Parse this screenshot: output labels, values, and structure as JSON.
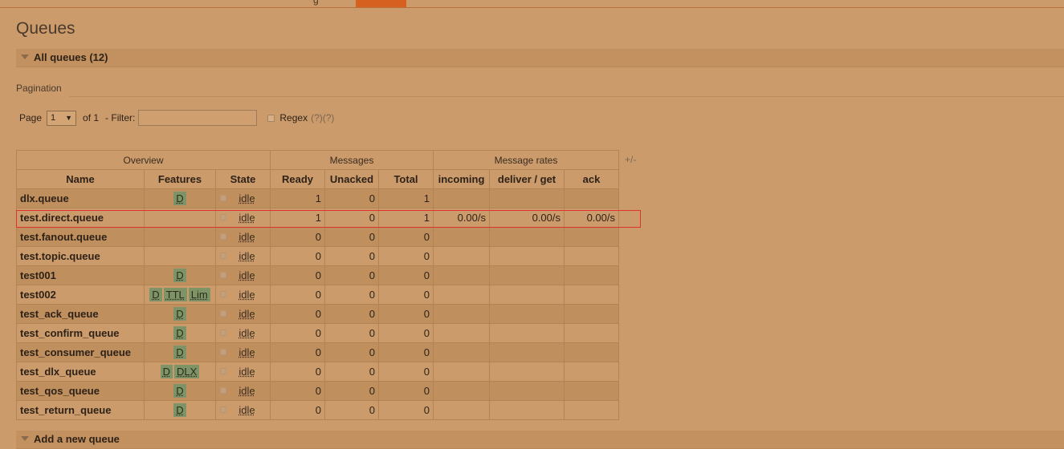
{
  "topnav": {
    "stub_text": "g"
  },
  "page": {
    "title": "Queues",
    "all_queues_label": "All queues (12)",
    "pagination_label": "Pagination",
    "add_queue_label": "Add a new queue"
  },
  "pager": {
    "page_label": "Page",
    "page_value": "1",
    "of_label": "of 1",
    "filter_label": "- Filter:",
    "filter_value": "",
    "regex_label": "Regex",
    "help1": "(?)",
    "help2": "(?)"
  },
  "table": {
    "groups": [
      "Overview",
      "Messages",
      "Message rates"
    ],
    "plus_minus": "+/-",
    "columns": [
      "Name",
      "Features",
      "State",
      "Ready",
      "Unacked",
      "Total",
      "incoming",
      "deliver / get",
      "ack"
    ],
    "rows": [
      {
        "name": "dlx.queue",
        "features": [
          "D"
        ],
        "state": "idle",
        "ready": "1",
        "unacked": "0",
        "total": "1",
        "incoming": "",
        "deliver": "",
        "ack": ""
      },
      {
        "name": "test.direct.queue",
        "features": [],
        "state": "idle",
        "ready": "1",
        "unacked": "0",
        "total": "1",
        "incoming": "0.00/s",
        "deliver": "0.00/s",
        "ack": "0.00/s"
      },
      {
        "name": "test.fanout.queue",
        "features": [],
        "state": "idle",
        "ready": "0",
        "unacked": "0",
        "total": "0",
        "incoming": "",
        "deliver": "",
        "ack": ""
      },
      {
        "name": "test.topic.queue",
        "features": [],
        "state": "idle",
        "ready": "0",
        "unacked": "0",
        "total": "0",
        "incoming": "",
        "deliver": "",
        "ack": ""
      },
      {
        "name": "test001",
        "features": [
          "D"
        ],
        "state": "idle",
        "ready": "0",
        "unacked": "0",
        "total": "0",
        "incoming": "",
        "deliver": "",
        "ack": ""
      },
      {
        "name": "test002",
        "features": [
          "D",
          "TTL",
          "Lim"
        ],
        "state": "idle",
        "ready": "0",
        "unacked": "0",
        "total": "0",
        "incoming": "",
        "deliver": "",
        "ack": ""
      },
      {
        "name": "test_ack_queue",
        "features": [
          "D"
        ],
        "state": "idle",
        "ready": "0",
        "unacked": "0",
        "total": "0",
        "incoming": "",
        "deliver": "",
        "ack": ""
      },
      {
        "name": "test_confirm_queue",
        "features": [
          "D"
        ],
        "state": "idle",
        "ready": "0",
        "unacked": "0",
        "total": "0",
        "incoming": "",
        "deliver": "",
        "ack": ""
      },
      {
        "name": "test_consumer_queue",
        "features": [
          "D"
        ],
        "state": "idle",
        "ready": "0",
        "unacked": "0",
        "total": "0",
        "incoming": "",
        "deliver": "",
        "ack": ""
      },
      {
        "name": "test_dlx_queue",
        "features": [
          "D",
          "DLX"
        ],
        "state": "idle",
        "ready": "0",
        "unacked": "0",
        "total": "0",
        "incoming": "",
        "deliver": "",
        "ack": ""
      },
      {
        "name": "test_qos_queue",
        "features": [
          "D"
        ],
        "state": "idle",
        "ready": "0",
        "unacked": "0",
        "total": "0",
        "incoming": "",
        "deliver": "",
        "ack": ""
      },
      {
        "name": "test_return_queue",
        "features": [
          "D"
        ],
        "state": "idle",
        "ready": "0",
        "unacked": "0",
        "total": "0",
        "incoming": "",
        "deliver": "",
        "ack": ""
      }
    ]
  },
  "colors": {
    "page_bg": "#cb9b6b",
    "active_tab": "#d6601f",
    "badge_bg": "#7f9466",
    "highlight": "#e0322f"
  }
}
